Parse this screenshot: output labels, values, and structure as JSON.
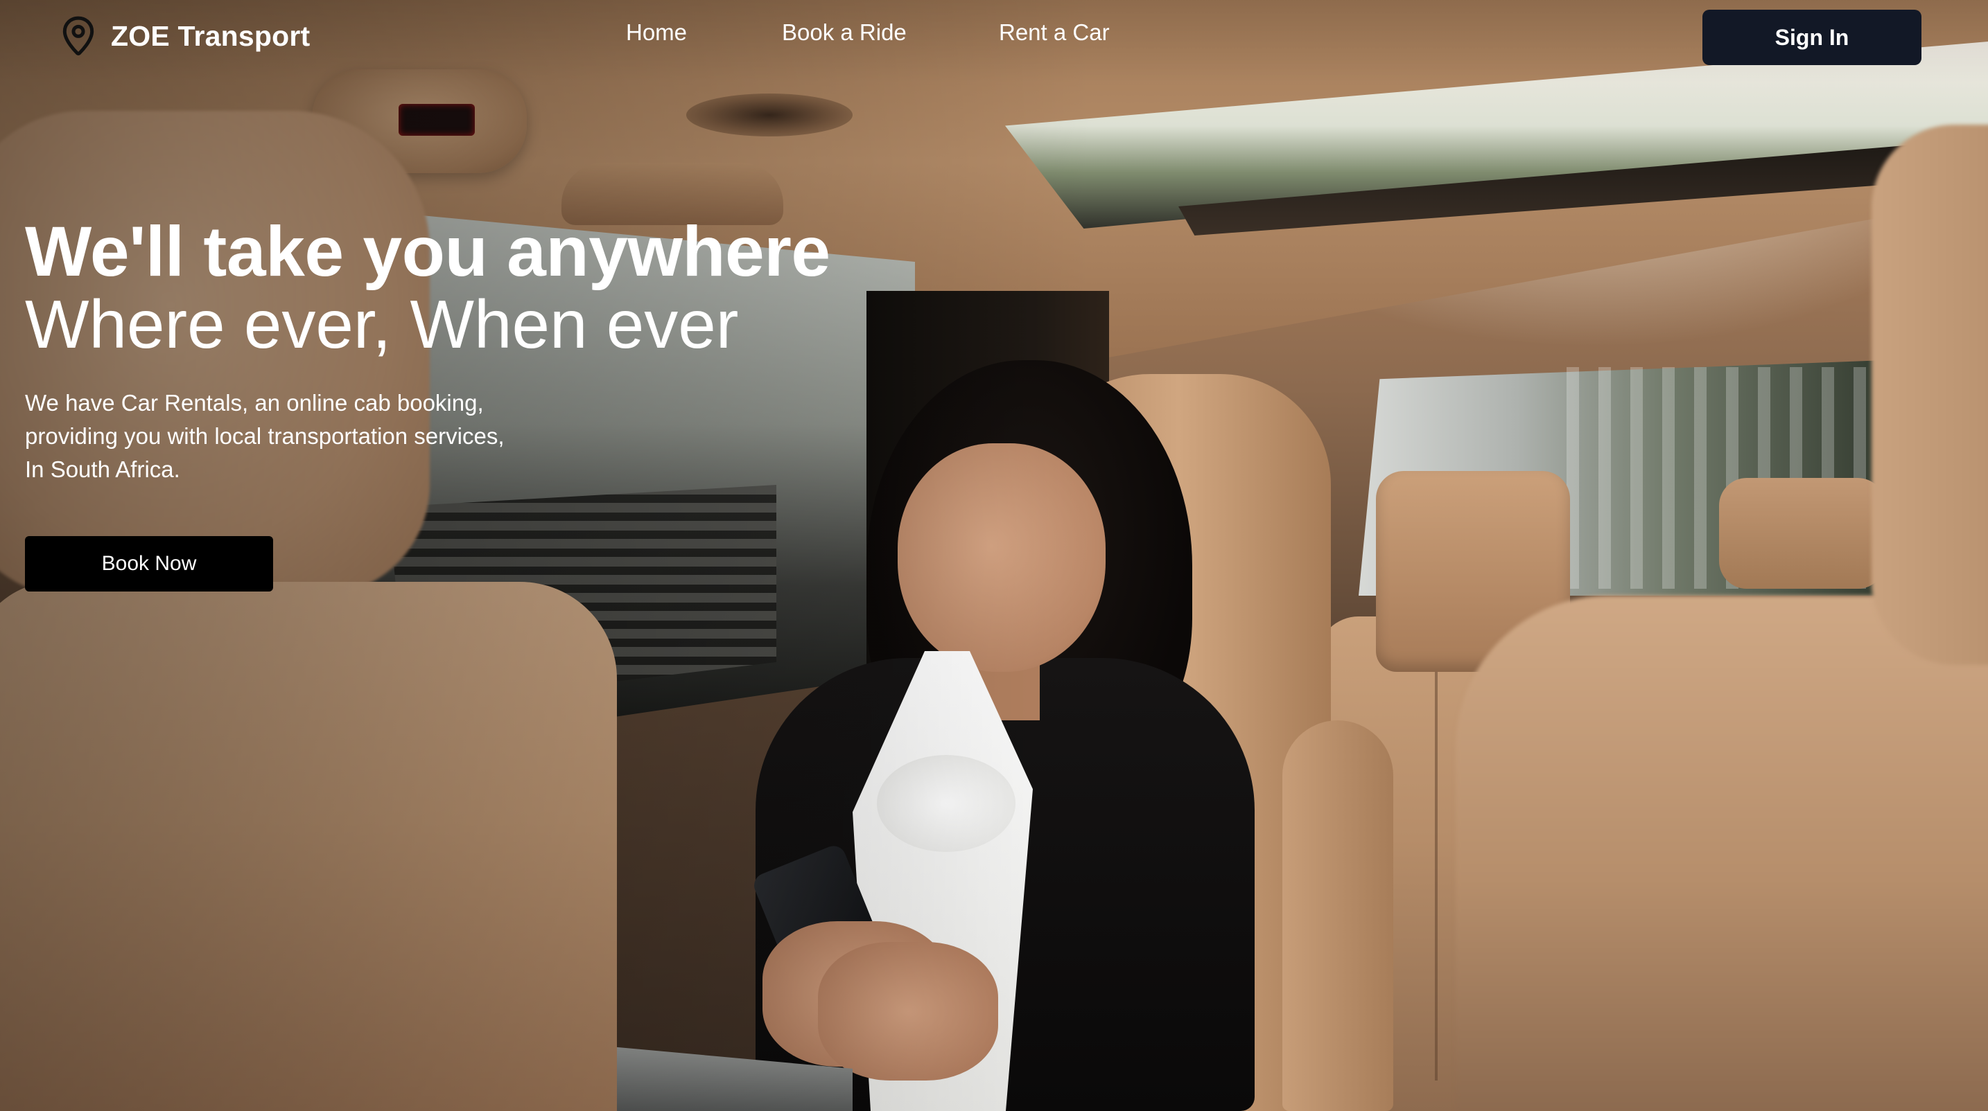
{
  "brand": {
    "name": "ZOE Transport",
    "icon": "map-pin-icon"
  },
  "nav": {
    "links": [
      {
        "label": "Home"
      },
      {
        "label": "Book a Ride"
      },
      {
        "label": "Rent a Car"
      }
    ],
    "signin_label": "Sign In"
  },
  "hero": {
    "title": "We'll take you anywhere",
    "subtitle": "Where ever, When ever",
    "description_lines": [
      "We have Car Rentals, an online cab booking,",
      "providing you with local transportation services,",
      "In South Africa."
    ],
    "cta_label": "Book Now"
  },
  "colors": {
    "signin_bg": "#121826",
    "cta_bg": "#000000",
    "text": "#ffffff"
  }
}
